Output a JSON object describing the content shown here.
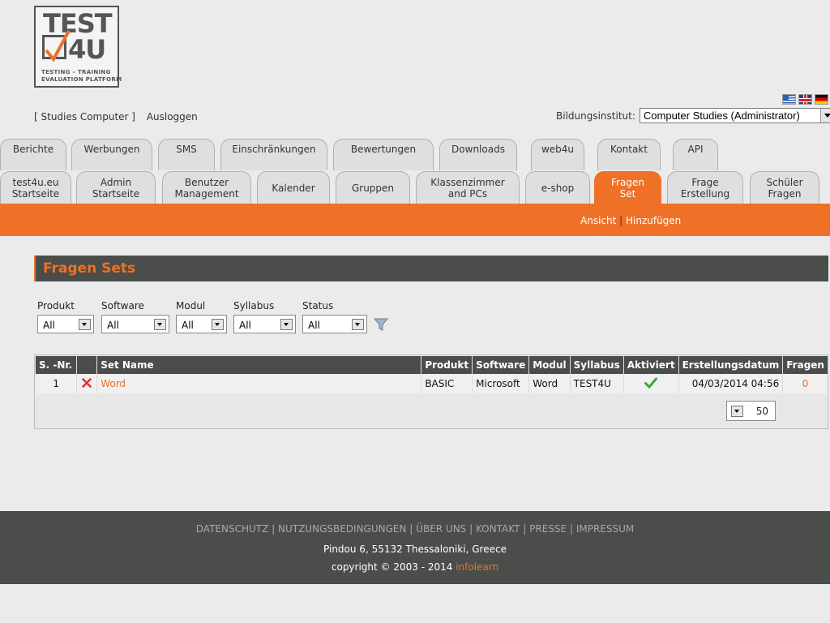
{
  "logo": {
    "line1": "TEST",
    "line2": "4U",
    "tagline1": "TESTING  –  TRAINING",
    "tagline2": "EVALUATION PLATFORM"
  },
  "flags": [
    "greek-flag-icon",
    "uk-flag-icon",
    "german-flag-icon"
  ],
  "user": {
    "account": "[ Studies Computer ]",
    "logout": "Ausloggen"
  },
  "institute": {
    "label": "Bildungsinstitut:",
    "value": "Computer Studies (Administrator)"
  },
  "tabs_row1": [
    "Berichte",
    "Werbungen",
    "SMS",
    "Einschränkungen",
    "Bewertungen",
    "Downloads",
    "web4u",
    "Kontakt",
    "API"
  ],
  "tabs_row2": [
    "test4u.eu\nStartseite",
    "Admin\nStartseite",
    "Benutzer\nManagement",
    "Kalender",
    "Gruppen",
    "Klassenzimmer\nand PCs",
    "e-shop",
    "Fragen\nSet",
    "Frage\nErstellung",
    "Schüler\nFragen"
  ],
  "subnav": {
    "view": "Ansicht",
    "sep": " | ",
    "add": "Hinzufügen"
  },
  "section_title": "Fragen Sets",
  "filters": [
    {
      "label": "Produkt",
      "value": "All"
    },
    {
      "label": "Software",
      "value": "All"
    },
    {
      "label": "Modul",
      "value": "All"
    },
    {
      "label": "Syllabus",
      "value": "All"
    },
    {
      "label": "Status",
      "value": "All"
    }
  ],
  "table": {
    "headers": [
      "S. -Nr.",
      "",
      "Set Name",
      "Produkt",
      "Software",
      "Modul",
      "Syllabus",
      "Aktiviert",
      "Erstellungsdatum",
      "Fragen"
    ],
    "rows": [
      {
        "nr": "1",
        "name": "Word",
        "produkt": "BASIC",
        "software": "Microsoft",
        "modul": "Word",
        "syllabus": "TEST4U",
        "aktiviert": "check-icon",
        "datum": "04/03/2014 04:56",
        "fragen": "0"
      }
    ]
  },
  "pager": {
    "per_page": "50"
  },
  "footer": {
    "links": [
      "DATENSCHUTZ",
      "NUTZUNGSBEDINGUNGEN",
      "ÜBER UNS",
      "KONTAKT",
      "PRESSE",
      "IMPRESSUM"
    ],
    "address": "Pindou 6, 55132 Thessaloniki, Greece",
    "copyright": "copyright © 2003 - 2014 ",
    "company": "infolearn"
  },
  "colors": {
    "accent": "#ee7127",
    "dark": "#4b4d4a",
    "background": "#ebebeb"
  }
}
